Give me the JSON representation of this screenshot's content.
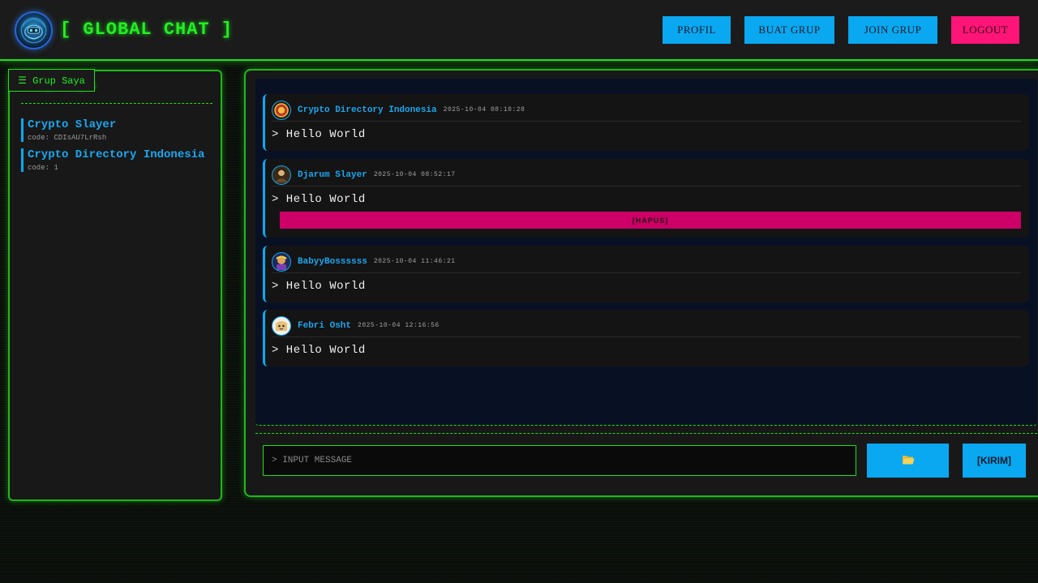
{
  "header": {
    "title": "[ GLOBAL CHAT ]",
    "logo_icon": "robot-globe-logo",
    "nav": {
      "profile": "PROFIL",
      "create_group": "BUAT GRUP",
      "join_group": "JOIN GRUP",
      "logout": "LOGOUT"
    }
  },
  "sidebar": {
    "toggle_label": "☰ Grup Saya",
    "heading": "Grup Saya",
    "groups": [
      {
        "name": "Crypto Slayer",
        "code": "code: CDIsAU7LrRsh"
      },
      {
        "name": "Crypto Directory Indonesia",
        "code": "code: 1"
      }
    ]
  },
  "chat": {
    "messages": [
      {
        "user": "Crypto Directory Indonesia",
        "time": "2025-10-04 08:10:28",
        "text": "> Hello World"
      },
      {
        "user": "Djarum Slayer",
        "time": "2025-10-04 08:52:17",
        "text": "> Hello World",
        "delete_label": "[HAPUS]"
      },
      {
        "user": "BabyyBossssss",
        "time": "2025-10-04 11:46:21",
        "text": "> Hello World"
      },
      {
        "user": "Febri Osht",
        "time": "2025-10-04 12:16:56",
        "text": "> Hello World"
      }
    ],
    "input_placeholder": "> INPUT MESSAGE",
    "attach_icon": "folder-icon",
    "send_label": "[KIRIM]"
  },
  "colors": {
    "accent_green": "#22e01a",
    "accent_blue": "#0aa8f0",
    "danger_pink": "#ff1478",
    "delete_pink": "#cc0066"
  }
}
